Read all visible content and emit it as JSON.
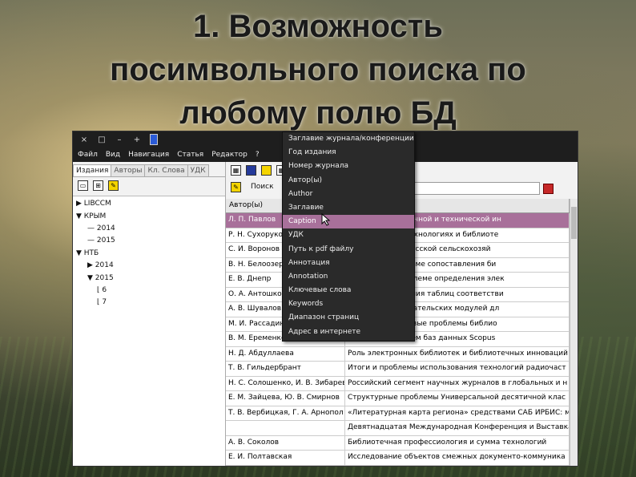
{
  "slide": {
    "title_lines": [
      "1. Возможность",
      "посимвольного поиска по",
      "любому полю БД"
    ]
  },
  "window": {
    "titlebar_icons": [
      "×",
      "□",
      "–",
      "+"
    ],
    "menu": [
      "Файл",
      "Вид",
      "Навигация",
      "Статья",
      "Редактор",
      "?"
    ]
  },
  "left_panel": {
    "tabs": [
      "Издания",
      "Авторы",
      "Кл. Слова",
      "УДК"
    ],
    "tree": [
      {
        "label": "▶ LIBCCM",
        "level": 0
      },
      {
        "label": "▼ КРЫМ",
        "level": 0
      },
      {
        "label": "2014",
        "level": 1
      },
      {
        "label": "2015",
        "level": 1
      },
      {
        "label": "▼ НТБ",
        "level": 0
      },
      {
        "label": "▶ 2014",
        "level": 1
      },
      {
        "label": "▼ 2015",
        "level": 1
      },
      {
        "label": "6",
        "level": 2
      },
      {
        "label": "7",
        "level": 2
      }
    ]
  },
  "search": {
    "button_label": "Поиск"
  },
  "table": {
    "header": [
      "Автор(ы)",
      ""
    ],
    "rows": [
      [
        "Л. П. Павлов",
        "ках источник научной и технической ин"
      ],
      [
        "Р. Н. Сухоруко",
        "ении» о новых технологиях и библиоте"
      ],
      [
        "С. И. Воронов",
        "е ресурсы Белорусской сельскохозяй"
      ],
      [
        "В. Н. Белоозер",
        "е словари в системе сопоставления би"
      ],
      [
        "Е. В. Днепр",
        "решении» в проблеме определения элек"
      ],
      [
        "О. А. Антошко",
        "бенностях создания таблиц соответстви"
      ],
      [
        "А. В. Шувалов",
        "нальных пользовательских модулей дл"
      ],
      [
        "М. И. Рассадин",
        "минатив?! Кадровые проблемы библио"
      ],
      [
        "В. М. Еременко",
        "фикационных схем баз данных Scopus"
      ],
      [
        "Н. Д. Абдуллаева",
        "Роль электронных библиотек и библиотечных инноваций"
      ],
      [
        "Т. В. Гильдербрант",
        "Итоги и проблемы использования технологий радиочаст"
      ],
      [
        "Н. С. Солошенко, И. В. Зибарев",
        "Российский сегмент научных журналов в глобальных и н"
      ],
      [
        "Е. М. Зайцева, Ю. В. Смирнов",
        "Структурные проблемы Универсальной десятичной клас"
      ],
      [
        "Т. В. Вербицкая, Г. А. Арнопол",
        "«Литературная карта региона» средствами САБ ИРБИС: м"
      ],
      [
        "",
        "Девятнадцатая Международная Конференция и Выставка"
      ],
      [
        "А. В. Соколов",
        "Библиотечная профессиология и сумма технологий"
      ],
      [
        "Е. И. Полтавская",
        "Исследование объектов смежных документо-коммуника"
      ]
    ]
  },
  "dropdown": {
    "items": [
      "Заглавие журнала/конференции",
      "Год издания",
      "Номер журнала",
      "Автор(ы)",
      "Author",
      "Заглавие",
      "Caption",
      "УДК",
      "Путь к pdf файлу",
      "Аннотация",
      "Annotation",
      "Ключевые слова",
      "Keywords",
      "Диапазон страниц",
      "Адрес в интернете"
    ],
    "highlighted_index": 6
  }
}
